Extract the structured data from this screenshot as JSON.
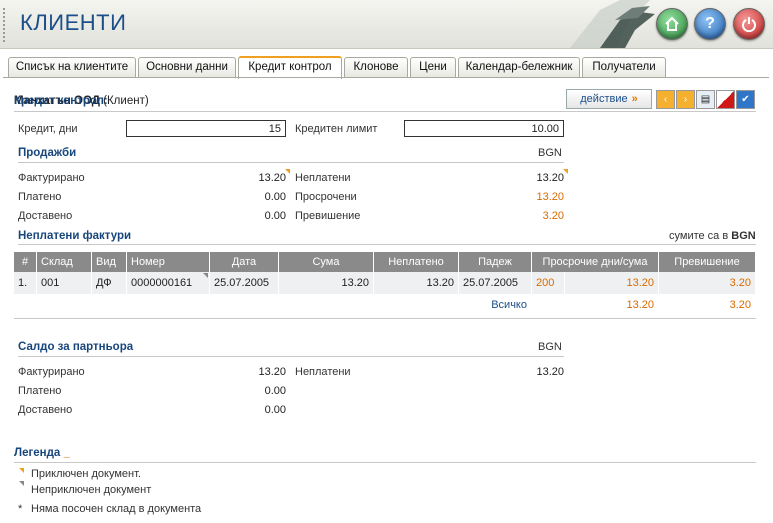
{
  "app": {
    "title": "КЛИЕНТИ"
  },
  "header_buttons": {
    "home": "home",
    "help": "?",
    "power": "power"
  },
  "tabs": [
    {
      "label": "Списък на клиентите"
    },
    {
      "label": "Основни данни"
    },
    {
      "label": "Кредит контрол"
    },
    {
      "label": "Клонове"
    },
    {
      "label": "Цени"
    },
    {
      "label": "Календар-бележник"
    },
    {
      "label": "Получатели"
    }
  ],
  "credit": {
    "title_label": "Кредит контрол:",
    "client_name": "Манхатън ООД",
    "client_role": "(Клиент)",
    "action_label": "действие",
    "days_label": "Кредит, дни",
    "days_value": "15",
    "limit_label": "Кредитен лимит",
    "limit_value": "10.00"
  },
  "sales": {
    "title": "Продажби",
    "currency": "BGN",
    "invoiced_label": "Фактурирано",
    "invoiced_value": "13.20",
    "paid_label": "Платено",
    "paid_value": "0.00",
    "delivered_label": "Доставено",
    "delivered_value": "0.00",
    "unpaid_label": "Неплатени",
    "unpaid_value": "13.20",
    "overdue_label": "Просрочени",
    "overdue_value": "13.20",
    "excess_label": "Превишение",
    "excess_value": "3.20"
  },
  "unpaid": {
    "title": "Неплатени фактури",
    "note_prefix": "сумите са в",
    "note_currency": "BGN",
    "columns": [
      "#",
      "Склад",
      "Вид",
      "Номер",
      "Дата",
      "Сума",
      "Неплатено",
      "Падеж",
      "Просрочие дни/сума",
      "Превишение"
    ],
    "rows": [
      [
        "1.",
        "001",
        "ДФ",
        "0000000161",
        "25.07.2005",
        "13.20",
        "13.20",
        "25.07.2005",
        "200",
        "13.20",
        "3.20"
      ]
    ],
    "total_label": "Всичко",
    "total_overdue": "13.20",
    "total_excess": "3.20"
  },
  "partner": {
    "title": "Салдо за партньора",
    "currency": "BGN",
    "invoiced_label": "Фактурирано",
    "invoiced_value": "13.20",
    "paid_label": "Платено",
    "paid_value": "0.00",
    "delivered_label": "Доставено",
    "delivered_value": "0.00",
    "unpaid_label": "Неплатени",
    "unpaid_value": "13.20"
  },
  "legend": {
    "title": "Легенда",
    "closed": "Приключен документ.",
    "open": "Неприключен документ",
    "asterisk": "*",
    "no_store": "Няма посочен склад в документа"
  }
}
